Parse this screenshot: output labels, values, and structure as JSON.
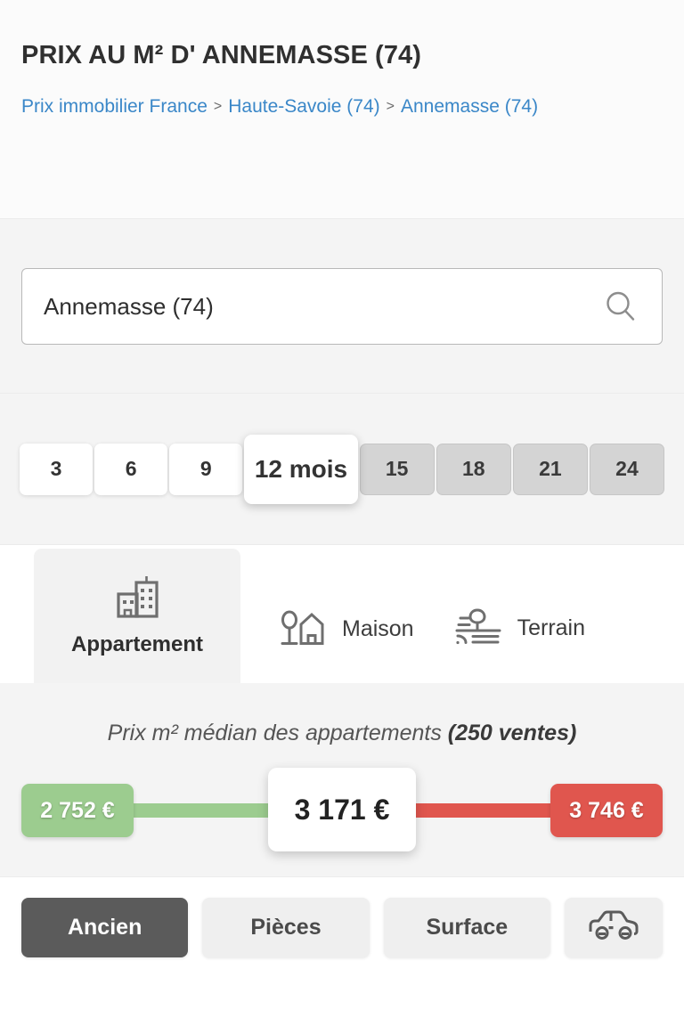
{
  "header": {
    "title": "PRIX AU M² D' ANNEMASSE (74)",
    "breadcrumb": {
      "items": [
        {
          "label": "Prix immobilier France"
        },
        {
          "label": "Haute-Savoie (74)"
        },
        {
          "label": "Annemasse (74)"
        }
      ],
      "separator": ">"
    }
  },
  "search": {
    "value": "Annemasse (74)",
    "placeholder": "Annemasse (74)",
    "icon": "search-icon"
  },
  "period": {
    "options": [
      {
        "label": "3",
        "state": "plain"
      },
      {
        "label": "6",
        "state": "plain"
      },
      {
        "label": "9",
        "state": "plain"
      },
      {
        "label": "12 mois",
        "state": "active"
      },
      {
        "label": "15",
        "state": "muted"
      },
      {
        "label": "18",
        "state": "muted"
      },
      {
        "label": "21",
        "state": "muted"
      },
      {
        "label": "24",
        "state": "muted"
      }
    ],
    "selected": "12 mois"
  },
  "property_tabs": [
    {
      "label": "Appartement",
      "icon": "building-icon",
      "active": true
    },
    {
      "label": "Maison",
      "icon": "house-tree-icon",
      "active": false
    },
    {
      "label": "Terrain",
      "icon": "land-tree-icon",
      "active": false
    }
  ],
  "price": {
    "caption_plain": "Prix m² médian des appartements ",
    "caption_bold": "(250 ventes)",
    "low": "2 752 €",
    "median": "3 171 €",
    "high": "3 746 €",
    "colors": {
      "low": "#9ccc8f",
      "high": "#e0564e",
      "median_bg": "#ffffff",
      "link": "#3a87c8"
    }
  },
  "filters": [
    {
      "label": "Ancien",
      "active": true
    },
    {
      "label": "Pièces",
      "active": false
    },
    {
      "label": "Surface",
      "active": false
    },
    {
      "label": "",
      "icon": "car-icon",
      "active": false
    }
  ]
}
